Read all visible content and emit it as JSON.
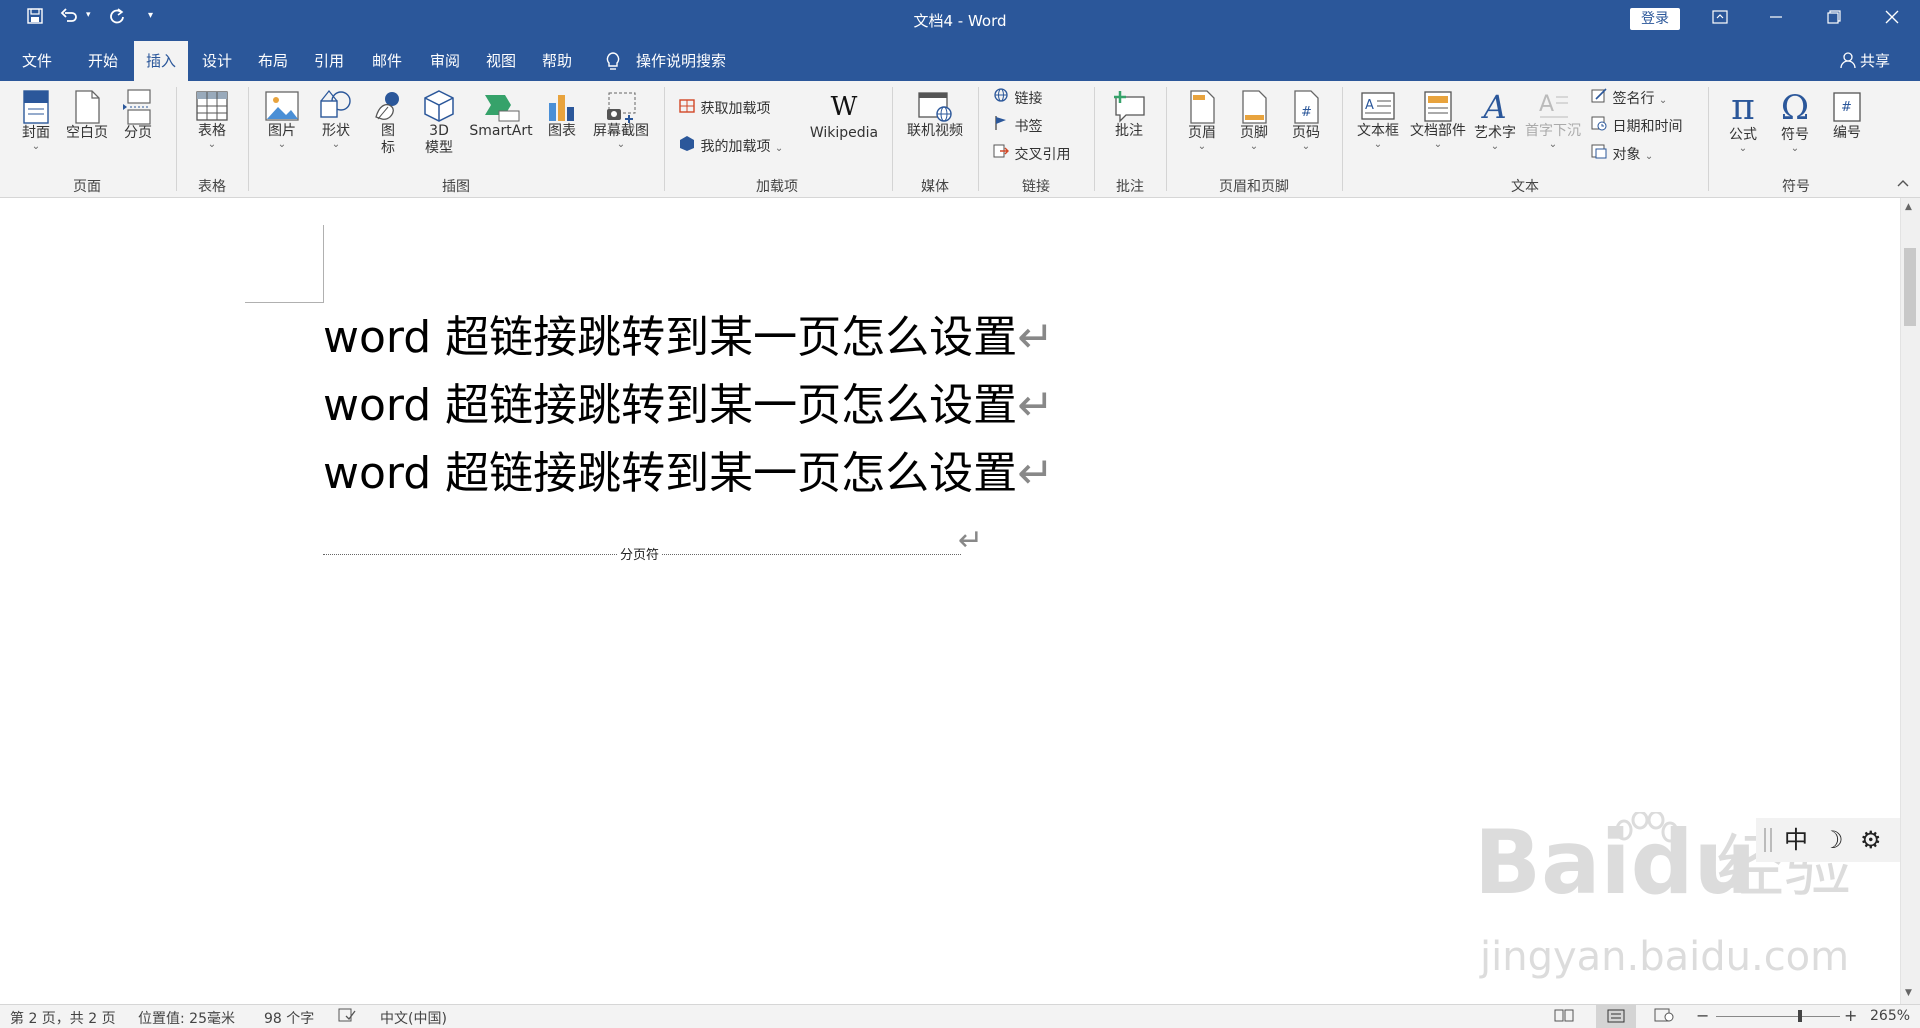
{
  "quick_access": {
    "save_icon": "save-icon",
    "undo_icon": "undo-icon",
    "redo_icon": "redo-icon",
    "customize_icon": "customize-icon"
  },
  "window": {
    "title": "文档4 - Word",
    "login": "登录",
    "share": "共享"
  },
  "tabs": [
    "文件",
    "开始",
    "插入",
    "设计",
    "布局",
    "引用",
    "邮件",
    "审阅",
    "视图",
    "帮助"
  ],
  "active_tab": "插入",
  "tell_me": "操作说明搜索",
  "ribbon": {
    "groups": {
      "pages": {
        "label": "页面",
        "buttons": [
          "封面",
          "空白页",
          "分页"
        ]
      },
      "tables": {
        "label": "表格",
        "buttons": [
          "表格"
        ]
      },
      "illustrations": {
        "label": "插图",
        "buttons": [
          "图片",
          "形状",
          "图",
          "标",
          "3D",
          "模型",
          "SmartArt",
          "图表",
          "屏幕截图"
        ]
      },
      "addins": {
        "label": "加载项",
        "buttons": [
          "获取加载项",
          "我的加载项",
          "Wikipedia"
        ]
      },
      "media": {
        "label": "媒体",
        "buttons": [
          "联机视频"
        ]
      },
      "links": {
        "label": "链接",
        "buttons": [
          "链接",
          "书签",
          "交叉引用"
        ]
      },
      "comments": {
        "label": "批注",
        "buttons": [
          "批注"
        ]
      },
      "header_footer": {
        "label": "页眉和页脚",
        "buttons": [
          "页眉",
          "页脚",
          "页码"
        ]
      },
      "text": {
        "label": "文本",
        "buttons": [
          "文本框",
          "文档部件",
          "艺术字",
          "首字下沉",
          "签名行",
          "日期和时间",
          "对象"
        ]
      },
      "symbols": {
        "label": "符号",
        "buttons": [
          "公式",
          "符号",
          "编号"
        ]
      }
    }
  },
  "document": {
    "lines": [
      "word 超链接跳转到某一页怎么设置",
      "word 超链接跳转到某一页怎么设置",
      "word 超链接跳转到某一页怎么设置"
    ],
    "paragraph_mark": "↵",
    "page_break": "分页符"
  },
  "ime": {
    "mode": "中"
  },
  "watermark": {
    "brand": "Baidu",
    "cn": "经验",
    "url": "jingyan.baidu.com"
  },
  "status": {
    "page": "第 2 页，共 2 页",
    "position": "位置值: 25毫米",
    "words": "98 个字",
    "language": "中文(中国)",
    "zoom": "265%",
    "zoom_level_percent": 265
  },
  "colors": {
    "accent": "#2b579a",
    "ribbon_bg": "#f3f3f3"
  }
}
